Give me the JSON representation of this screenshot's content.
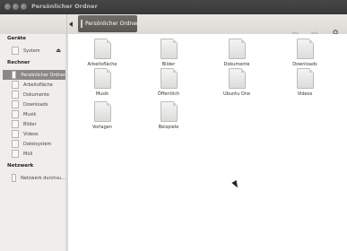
{
  "window": {
    "title": "Persönlicher Ordner"
  },
  "toolbar": {
    "path_label": "Persönlicher Ordner",
    "back_label": "Zurück",
    "forward_label": "Vor",
    "search_label": "Suchen"
  },
  "sidebar": {
    "sections": [
      {
        "title": "Geräte",
        "items": [
          {
            "label": "System",
            "eject": true
          }
        ]
      },
      {
        "title": "Rechner",
        "items": [
          {
            "label": "Persönlicher Ordner",
            "selected": true
          },
          {
            "label": "Arbeitsfläche"
          },
          {
            "label": "Dokumente"
          },
          {
            "label": "Downloads"
          },
          {
            "label": "Musik"
          },
          {
            "label": "Bilder"
          },
          {
            "label": "Videos"
          },
          {
            "label": "Dateisystem"
          },
          {
            "label": "Müll"
          }
        ]
      },
      {
        "title": "Netzwerk",
        "items": [
          {
            "label": "Netzwerk durchsu..."
          }
        ]
      }
    ]
  },
  "files": [
    {
      "label": "Arbeitsfläche"
    },
    {
      "label": "Bilder"
    },
    {
      "label": "Dokumente"
    },
    {
      "label": "Downloads"
    },
    {
      "label": "Musik"
    },
    {
      "label": "Öffentlich"
    },
    {
      "label": "Ubuntu One"
    },
    {
      "label": "Videos"
    },
    {
      "label": "Vorlagen"
    },
    {
      "label": "Beispiele"
    }
  ]
}
